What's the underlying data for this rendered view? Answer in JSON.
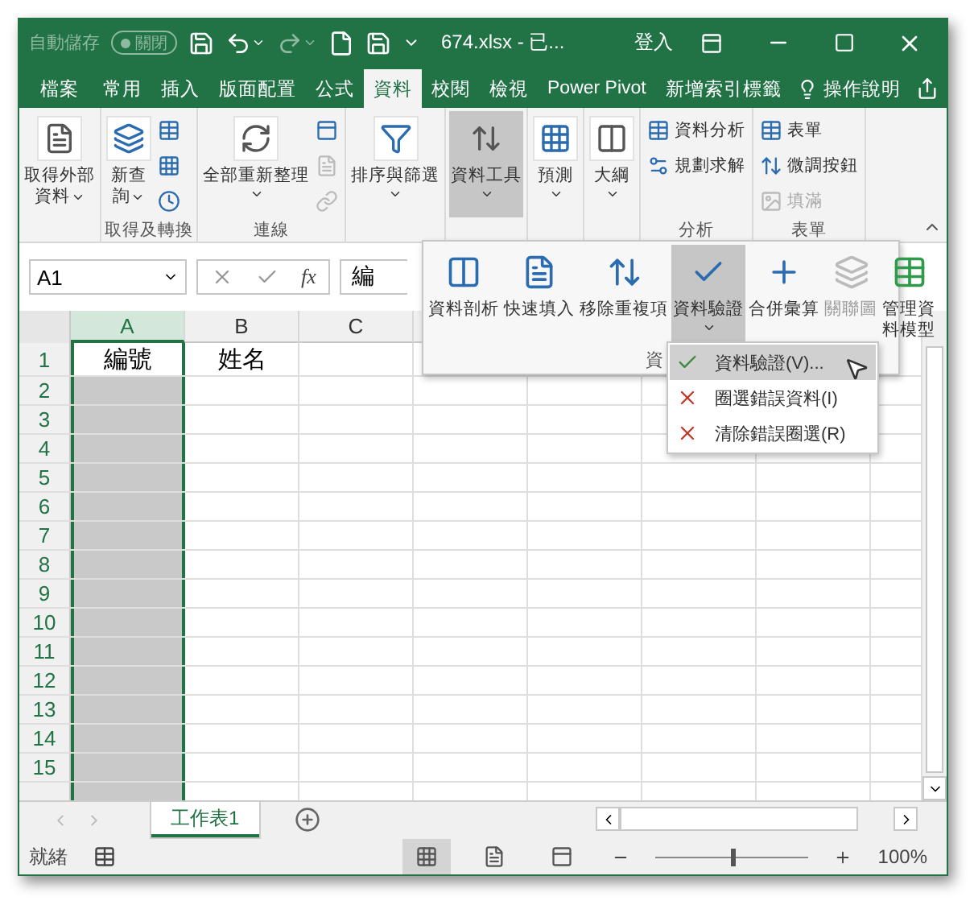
{
  "title_bar": {
    "autosave_label": "自動儲存",
    "autosave_toggle": "關閉",
    "autosave_on": false,
    "filename": "674.xlsx  -  已...",
    "sign_in": "登入"
  },
  "tabs": [
    {
      "label": "檔案",
      "selected": false
    },
    {
      "label": "常用",
      "selected": false
    },
    {
      "label": "插入",
      "selected": false
    },
    {
      "label": "版面配置",
      "selected": false
    },
    {
      "label": "公式",
      "selected": false
    },
    {
      "label": "資料",
      "selected": true
    },
    {
      "label": "校閱",
      "selected": false
    },
    {
      "label": "檢視",
      "selected": false
    },
    {
      "label": "Power Pivot",
      "selected": false
    },
    {
      "label": "新增索引標籤",
      "selected": false
    }
  ],
  "tell_me": "操作說明",
  "ribbon": {
    "groups": [
      {
        "large": [
          {
            "lines": [
              "取得外部",
              "資料"
            ],
            "menu": true,
            "selected": false
          }
        ]
      },
      {
        "label": "取得及轉換",
        "large": [
          {
            "lines": [
              "新查",
              "詢"
            ],
            "menu": true,
            "selected": false
          }
        ],
        "small": [
          {
            "disabled": false
          },
          {
            "disabled": false
          },
          {
            "disabled": false
          }
        ]
      },
      {
        "label": "連線",
        "large": [
          {
            "lines": [
              "全部重新整理"
            ],
            "menu": true,
            "selected": false
          }
        ],
        "small": [
          {
            "disabled": false
          },
          {
            "disabled": true
          },
          {
            "disabled": true
          }
        ]
      },
      {
        "large": [
          {
            "lines": [
              "排序與篩選"
            ],
            "menu": true,
            "selected": false
          }
        ]
      },
      {
        "large": [
          {
            "lines": [
              "資料工具"
            ],
            "menu": true,
            "selected": true
          }
        ]
      },
      {
        "large": [
          {
            "lines": [
              "預測"
            ],
            "menu": true,
            "selected": false
          }
        ]
      },
      {
        "large": [
          {
            "lines": [
              "大綱"
            ],
            "menu": true,
            "selected": false
          }
        ]
      },
      {
        "label": "分析",
        "small": [
          {
            "label": "資料分析",
            "disabled": false
          },
          {
            "label": "規劃求解",
            "disabled": false
          }
        ]
      },
      {
        "label": "表單",
        "small": [
          {
            "label": "表單",
            "disabled": false
          },
          {
            "label": "微調按鈕",
            "disabled": false
          },
          {
            "label": "填滿",
            "disabled": true
          }
        ]
      }
    ]
  },
  "formula_bar": {
    "name_box": "A1",
    "fx_label": "fx",
    "value": "編"
  },
  "columns": [
    {
      "label": "A",
      "selected": true
    },
    {
      "label": "B",
      "selected": false
    },
    {
      "label": "C",
      "selected": false
    }
  ],
  "rows": [
    {
      "number": "1",
      "cells": [
        "編號",
        "姓名"
      ]
    },
    {
      "number": "2"
    },
    {
      "number": "3"
    },
    {
      "number": "4"
    },
    {
      "number": "5"
    },
    {
      "number": "6"
    },
    {
      "number": "7"
    },
    {
      "number": "8"
    },
    {
      "number": "9"
    },
    {
      "number": "10"
    },
    {
      "number": "11"
    },
    {
      "number": "12"
    },
    {
      "number": "13"
    },
    {
      "number": "14"
    },
    {
      "number": "15"
    }
  ],
  "data_tools_gallery": {
    "group_label": "資",
    "items": [
      {
        "lines": [
          "資料剖析"
        ],
        "selected": false,
        "disabled": false
      },
      {
        "lines": [
          "快速填入"
        ],
        "selected": false,
        "disabled": false
      },
      {
        "lines": [
          "移除重複項"
        ],
        "selected": false,
        "disabled": false
      },
      {
        "lines": [
          "資料驗證"
        ],
        "selected": true,
        "disabled": false,
        "menu": true
      },
      {
        "lines": [
          "合併彙算"
        ],
        "selected": false,
        "disabled": false
      },
      {
        "lines": [
          "關聯圖"
        ],
        "selected": false,
        "disabled": true
      },
      {
        "lines": [
          "管理資",
          "料模型"
        ],
        "selected": false,
        "disabled": false
      }
    ]
  },
  "validation_menu": [
    {
      "label": "資料驗證(V)...",
      "selected": true
    },
    {
      "label": "圈選錯誤資料(I)",
      "selected": false
    },
    {
      "label": "清除錯誤圈選(R)",
      "selected": false
    }
  ],
  "sheet_tabs": [
    {
      "label": "工作表1",
      "selected": true
    }
  ],
  "status_bar": {
    "status": "就緒",
    "views": [
      {
        "selected": true
      },
      {
        "selected": false
      },
      {
        "selected": false
      }
    ],
    "zoom": {
      "level": 0.5,
      "reading": "100%"
    }
  }
}
